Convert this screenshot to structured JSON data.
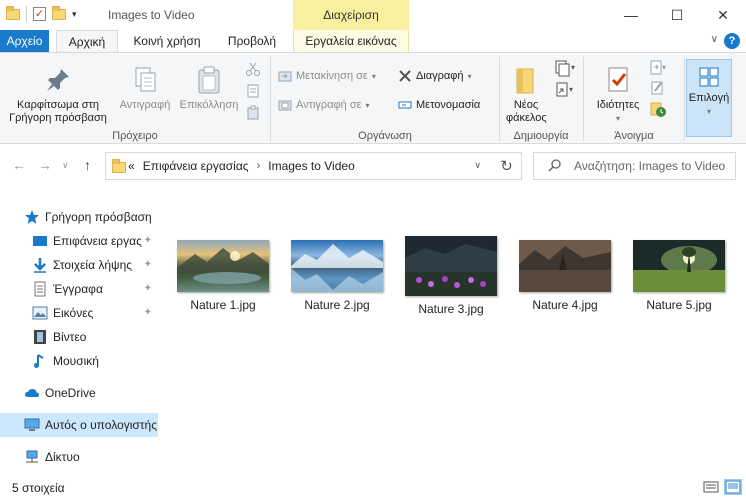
{
  "window": {
    "title": "Images to Video",
    "contextual_tab_header": "Διαχείριση",
    "minimize_glyph": "—",
    "maximize_glyph": "☐",
    "close_glyph": "✕"
  },
  "ribbon_tabs": [
    {
      "label": "Αρχείο"
    },
    {
      "label": "Αρχική"
    },
    {
      "label": "Κοινή χρήση"
    },
    {
      "label": "Προβολή"
    },
    {
      "label": "Εργαλεία εικόνας"
    }
  ],
  "help_glyph": "?",
  "ribbon": {
    "clipboard": {
      "label": "Πρόχειρο",
      "pin": "Καρφίτσωμα στη Γρήγορη πρόσβαση",
      "copy": "Αντιγραφή",
      "paste": "Επικόλληση"
    },
    "organize": {
      "label": "Οργάνωση",
      "move_to": "Μετακίνηση σε",
      "copy_to": "Αντιγραφή σε",
      "delete": "Διαγραφή",
      "rename": "Μετονομασία"
    },
    "new": {
      "label": "Δημιουργία",
      "new_folder": "Νέος φάκελος"
    },
    "open": {
      "label": "Άνοιγμα",
      "properties": "Ιδιότητες"
    },
    "select": {
      "label": "Επιλογή"
    }
  },
  "address": {
    "crumbs": [
      "Επιφάνεια εργασίας",
      "Images to Video"
    ],
    "overflow_glyph": "«",
    "separator_glyph": "›"
  },
  "search": {
    "placeholder": "Αναζήτηση: Images to Video"
  },
  "nav_pane": {
    "items": [
      {
        "label": "Γρήγορη πρόσβαση",
        "icon": "star-icon",
        "pinned": false
      },
      {
        "label": "Επιφάνεια εργας",
        "icon": "desktop-icon",
        "pinned": true
      },
      {
        "label": "Στοιχεία λήψης",
        "icon": "download-icon",
        "pinned": true
      },
      {
        "label": "Έγγραφα",
        "icon": "document-icon",
        "pinned": true
      },
      {
        "label": "Εικόνες",
        "icon": "pictures-icon",
        "pinned": true
      },
      {
        "label": "Βίντεο",
        "icon": "video-icon",
        "pinned": false
      },
      {
        "label": "Μουσική",
        "icon": "music-icon",
        "pinned": false
      },
      {
        "label": "OneDrive",
        "icon": "cloud-icon",
        "pinned": false
      },
      {
        "label": "Αυτός ο υπολογιστής",
        "icon": "computer-icon",
        "pinned": false
      },
      {
        "label": "Δίκτυο",
        "icon": "network-icon",
        "pinned": false
      }
    ],
    "pin_glyph": "📌"
  },
  "files": [
    {
      "name": "Nature 1.jpg"
    },
    {
      "name": "Nature 2.jpg"
    },
    {
      "name": "Nature 3.jpg"
    },
    {
      "name": "Nature 4.jpg"
    },
    {
      "name": "Nature 5.jpg"
    }
  ],
  "status": {
    "item_count": "5 στοιχεία"
  },
  "colors": {
    "accent": "#1979ca",
    "manage_tab": "#f8ef9f",
    "selection": "#cce8ff"
  }
}
